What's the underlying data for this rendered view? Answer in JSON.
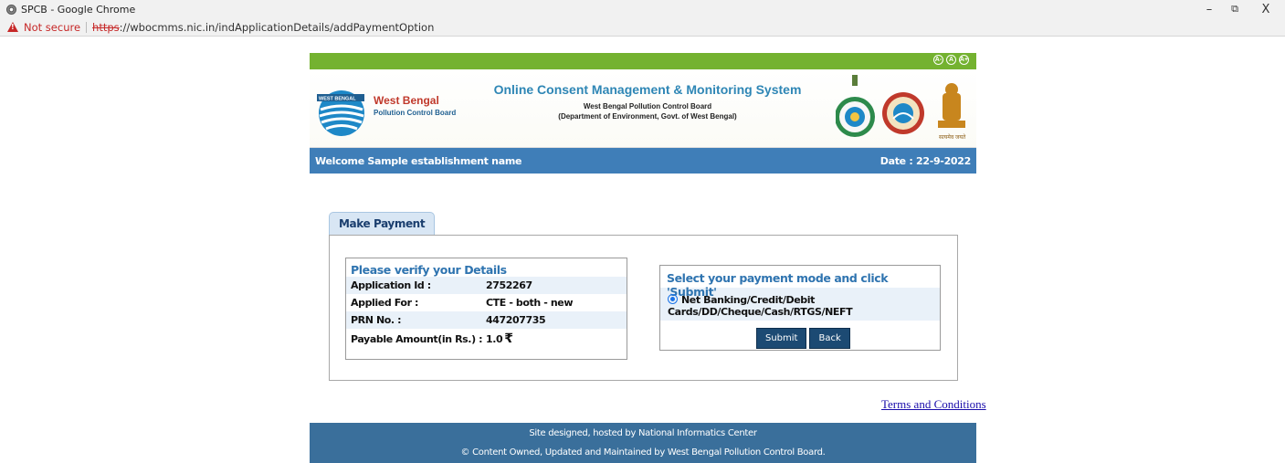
{
  "window": {
    "title": "SPCB - Google Chrome",
    "minimize": "–",
    "restore": "⧉",
    "close": "X"
  },
  "addressbar": {
    "security_label": "Not secure",
    "url_scheme": "https",
    "url_rest": "://wbocmms.nic.in/indApplicationDetails/addPaymentOption"
  },
  "header": {
    "org_name": "West Bengal",
    "org_sub": "Pollution Control Board",
    "system_title": "Online Consent Management & Monitoring System",
    "board_line": "West Bengal Pollution Control Board",
    "dept_line": "(Department of Environment, Govt. of West Bengal)",
    "accessibility": [
      "A-",
      "A",
      "A+"
    ]
  },
  "welcome": {
    "text": "Welcome Sample establishment name",
    "date": "Date : 22-9-2022"
  },
  "payment": {
    "tab_label": "Make Payment",
    "verify_title": "Please verify your Details",
    "rows": [
      {
        "label": "Application Id :",
        "value": "2752267"
      },
      {
        "label": "Applied For :",
        "value": "CTE - both - new"
      },
      {
        "label": "PRN No. :",
        "value": "447207735"
      },
      {
        "label": "Payable Amount(in Rs.) :",
        "value": "1.0",
        "currency": "₹"
      }
    ],
    "mode_title": "Select your payment mode and click 'Submit'",
    "mode_option_line1": "Net Banking/Credit/Debit",
    "mode_option_line2": "Cards/DD/Cheque/Cash/RTGS/NEFT",
    "submit_label": "Submit",
    "back_label": "Back"
  },
  "terms_label": "Terms and Conditions",
  "footer": {
    "line1": "Site designed, hosted by National Informatics Center",
    "line2": "© Content Owned, Updated and Maintained by West Bengal Pollution Control Board."
  },
  "colors": {
    "accent_blue": "#3f7eb8",
    "green_strip": "#74b230",
    "button": "#1c4a73"
  }
}
